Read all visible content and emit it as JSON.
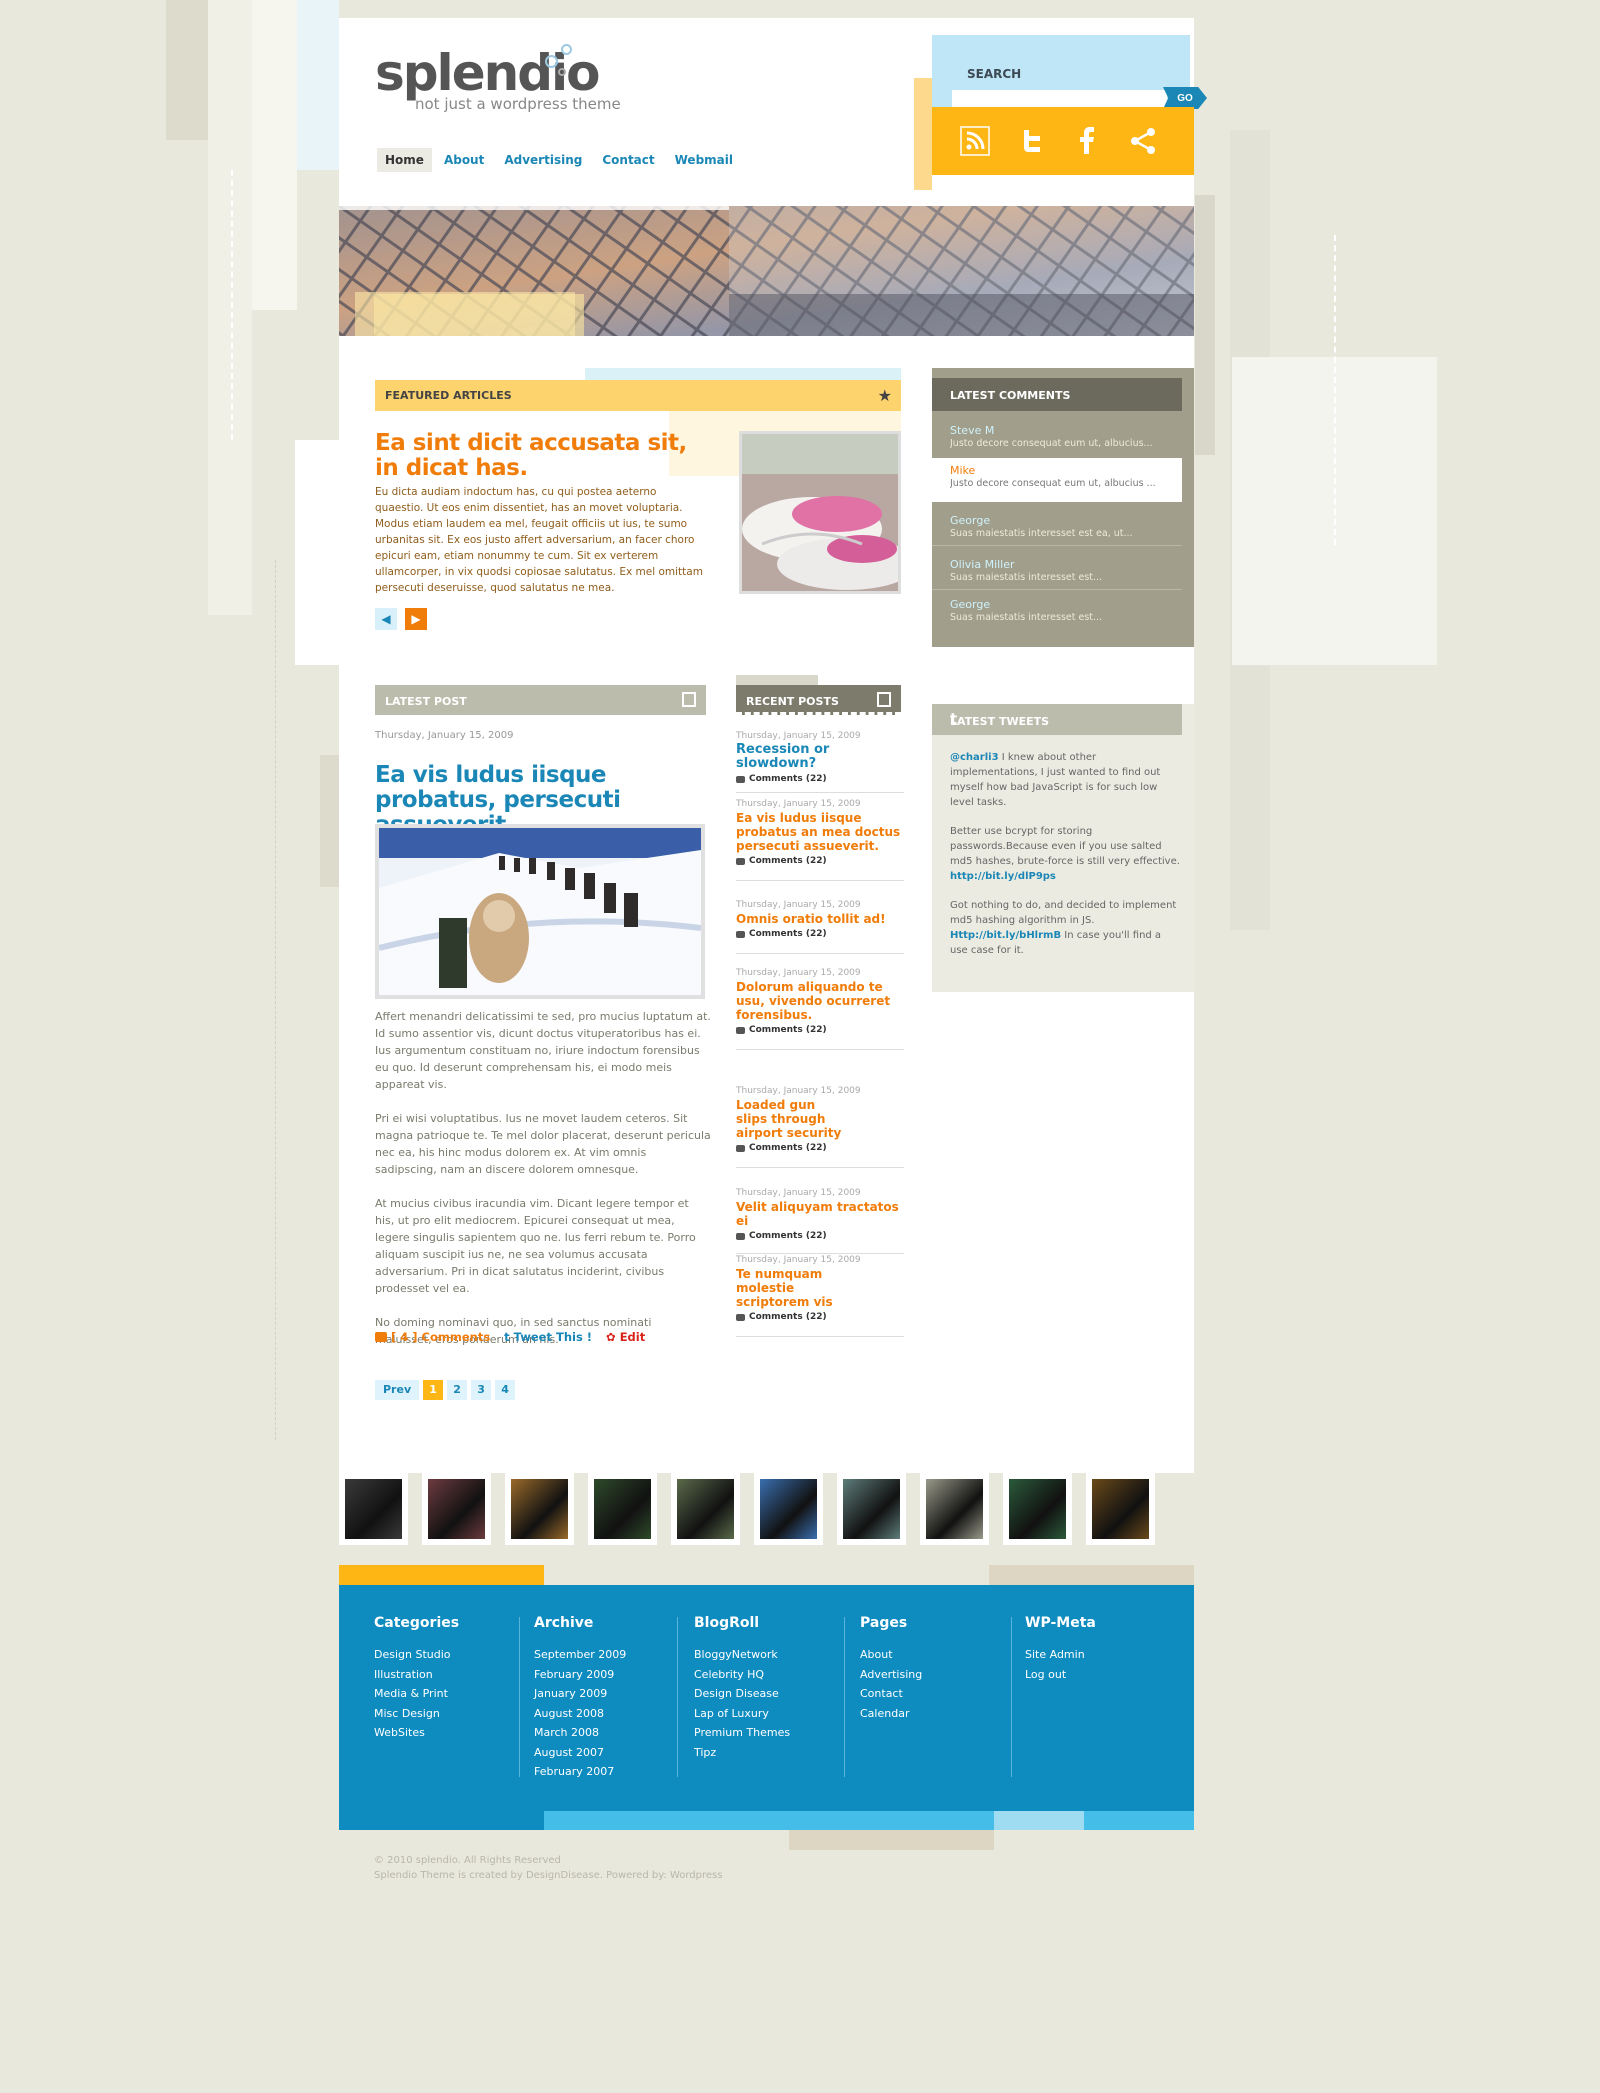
{
  "header": {
    "logo_title": "splendio",
    "logo_subtitle": "not just a wordpress theme",
    "nav": [
      "Home",
      "About",
      "Advertising",
      "Contact",
      "Webmail"
    ],
    "search_label": "SEARCH",
    "search_value": "",
    "search_button": "GO",
    "social_icons": [
      "rss-icon",
      "twitter-icon",
      "facebook-icon",
      "share-icon"
    ]
  },
  "featured": {
    "heading": "FEATURED ARTICLES",
    "title": "Ea sint dicit accusata sit, in dicat has.",
    "text": "Eu dicta audiam indoctum has, cu qui postea aeterno quaestio. Ut eos enim dissentiet, has an movet voluptaria. Modus etiam laudem ea mel, feugait officiis ut ius, te sumo urbanitas sit. Ex eos justo affert adversarium, an facer choro epicuri eam, etiam nonummy te cum. Sit ex verterem ullamcorper, in vix quodsi copiosae salutatus.  Ex mel omittam persecuti deseruisse, quod salutatus ne mea."
  },
  "latest_comments": {
    "heading": "LATEST COMMENTS",
    "items": [
      {
        "name": "Steve M",
        "text": "Justo decore consequat eum ut, albucius..."
      },
      {
        "name": "Mike",
        "text": "Justo decore consequat eum ut, albucius ..."
      },
      {
        "name": "George",
        "text": "Suas maiestatis interesset est ea, ut..."
      },
      {
        "name": "Olivia Miller",
        "text": "Suas maiestatis interesset est..."
      },
      {
        "name": "George",
        "text": "Suas maiestatis interesset est..."
      }
    ]
  },
  "latest_post": {
    "heading": "LATEST POST",
    "date": "Thursday, January 15, 2009",
    "title": "Ea vis ludus iisque probatus, persecuti assueverit.",
    "paragraphs": [
      "Affert menandri delicatissimi te sed, pro mucius luptatum at. Id sumo assentior vis, dicunt doctus vituperatoribus has ei. Ius argumentum constituam no, iriure indoctum forensibus eu quo. Id deserunt comprehensam his, ei modo meis appareat vis.",
      "Pri ei wisi voluptatibus. Ius ne movet laudem ceteros. Sit magna patrioque te. Te mel dolor placerat, deserunt pericula nec ea, his hinc modus dolorem ex. At vim omnis sadipscing, nam an discere dolorem omnesque.",
      "At mucius civibus iracundia vim. Dicant legere tempor et his, ut pro elit mediocrem. Epicurei consequat ut mea, legere singulis sapientem quo ne. Ius ferri rebum te. Porro aliquam suscipit ius ne, ne sea volumus accusata adversarium. Pri in dicat salutatus inciderint, civibus prodesset vel ea.",
      "No doming nominavi quo, in sed sanctus nominati maluisset, eros ponderum an his."
    ],
    "comments_link": "[ 4 ] Comments",
    "tweet_link": "Tweet This !",
    "edit_link": "Edit"
  },
  "pager": {
    "prev": "Prev",
    "pages": [
      "1",
      "2",
      "3",
      "4"
    ],
    "current": "1"
  },
  "recent_posts": {
    "heading": "RECENT POSTS",
    "items": [
      {
        "date": "Thursday, January 15, 2009",
        "title": "Recession or slowdown?",
        "comments": "Comments (22)"
      },
      {
        "date": "Thursday, January 15, 2009",
        "title": "Ea vis ludus iisque probatus an mea doctus persecuti assueverit.",
        "comments": "Comments (22)"
      },
      {
        "date": "Thursday, January 15, 2009",
        "title": "Omnis oratio tollit ad!",
        "comments": "Comments (22)"
      },
      {
        "date": "Thursday, January 15, 2009",
        "title": "Dolorum aliquando te usu, vivendo ocurreret forensibus.",
        "comments": "Comments (22)"
      },
      {
        "date": "Thursday, January 15, 2009",
        "title": "Loaded gun slips through airport security",
        "comments": "Comments (22)"
      },
      {
        "date": "Thursday, January 15, 2009",
        "title": "Velit aliquyam tractatos ei",
        "comments": "Comments (22)"
      },
      {
        "date": "Thursday, January 15, 2009",
        "title": "Te numquam molestie scriptorem vis",
        "comments": "Comments (22)"
      }
    ]
  },
  "tweets": {
    "heading": "LATEST TWEETS",
    "items": [
      {
        "handle": "@charli3",
        "text": " I knew about other implementations, I just wanted to find out myself how bad JavaScript is for such low level tasks."
      },
      {
        "handle": "",
        "text": "Better use bcrypt for storing passwords.Because even if you use salted md5 hashes, brute-force is still very effective. ",
        "link": "http://bit.ly/dlP9ps"
      },
      {
        "handle": "",
        "text": "Got nothing to do, and decided to implement md5 hashing algorithm in JS. ",
        "link": "Http://bit.ly/bHlrmB",
        "text2": " In case you'll find a use case for it."
      }
    ]
  },
  "thumbnail_colors": [
    "#3a3a3a",
    "#6d3b3f",
    "#9a6a2a",
    "#2e4a2a",
    "#5a6a4a",
    "#3a6fb0",
    "#5e7d7a",
    "#9a9a8a",
    "#2b5a3a",
    "#6a4a1a"
  ],
  "footer": {
    "columns": [
      {
        "title": "Categories",
        "links": [
          "Design Studio",
          "Illustration",
          "Media & Print",
          "Misc Design",
          "WebSites"
        ]
      },
      {
        "title": "Archive",
        "links": [
          "September 2009",
          "February 2009",
          "January 2009",
          "August 2008",
          "March 2008",
          "August 2007",
          "February 2007"
        ]
      },
      {
        "title": "BlogRoll",
        "links": [
          "BloggyNetwork",
          "Celebrity HQ",
          "Design Disease",
          "Lap of Luxury",
          "Premium Themes",
          "Tipz"
        ]
      },
      {
        "title": "Pages",
        "links": [
          "About",
          "Advertising",
          "Contact",
          "Calendar"
        ]
      },
      {
        "title": "WP-Meta",
        "links": [
          "Site Admin",
          "Log out"
        ]
      }
    ],
    "copyright_1": "© 2010 splendio. All Rights Reserved",
    "copyright_2": "Splendio Theme is created by DesignDisease. Powered by: Wordpress"
  },
  "colors": {
    "accent_blue": "#1b87b6",
    "accent_orange": "#f07c0a",
    "accent_yellow": "#fdb614",
    "footer_blue": "#0e8bbf"
  }
}
